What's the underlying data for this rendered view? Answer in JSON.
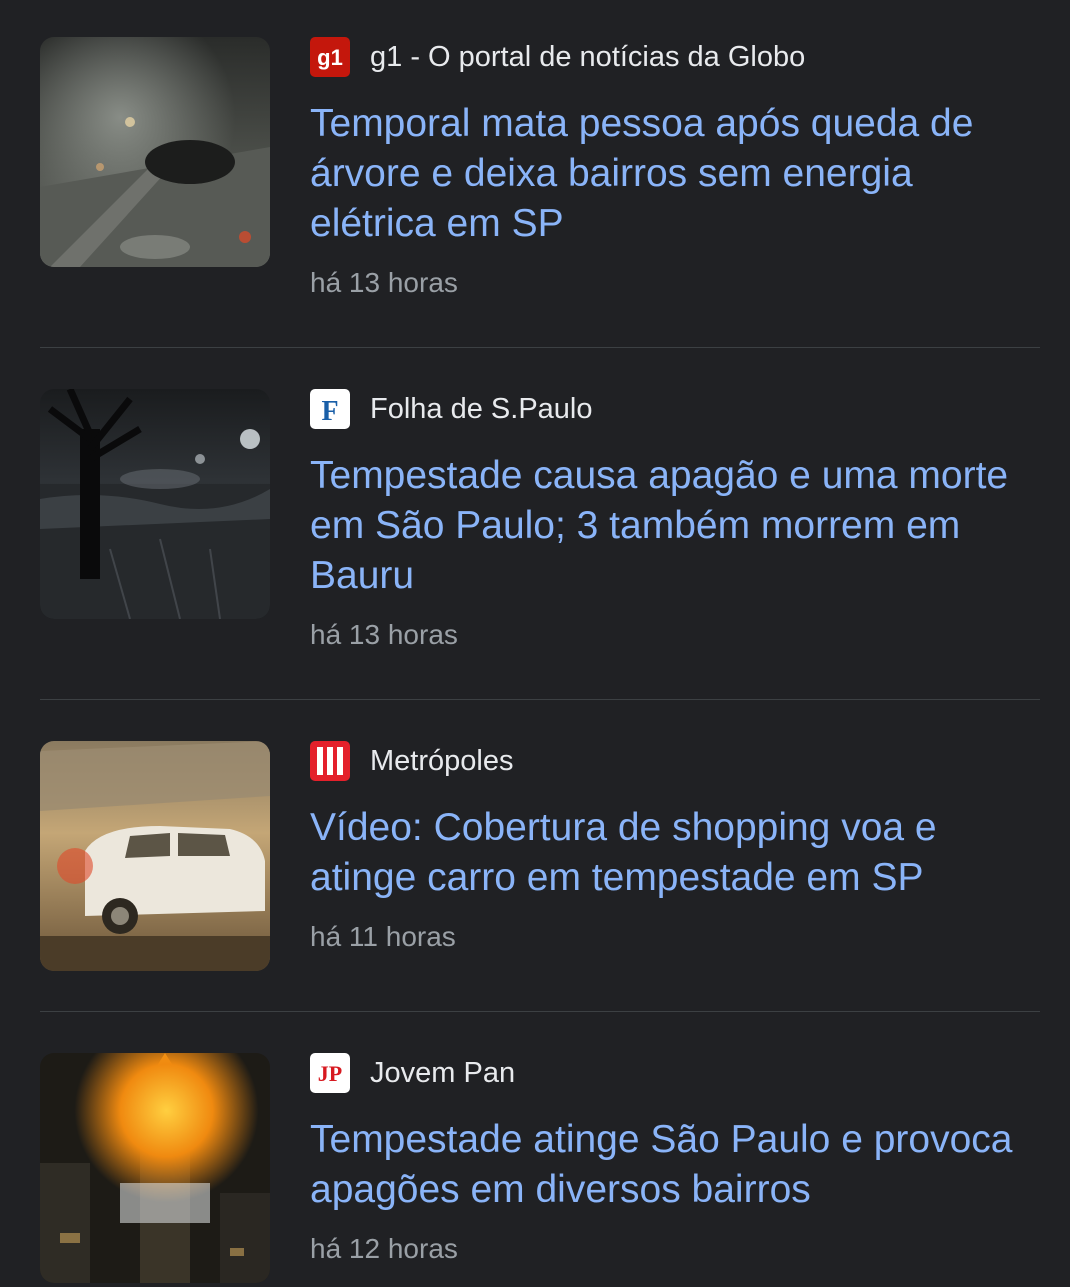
{
  "articles": [
    {
      "source": "g1 - O portal de notícias da Globo",
      "logo_icon": "g1-logo-icon",
      "logo_text": "g1",
      "headline": "Temporal mata pessoa após queda de árvore e deixa bairros sem energia elétrica em SP",
      "time": "há 13 horas",
      "thumbnail": "storm-street-night-image"
    },
    {
      "source": "Folha de S.Paulo",
      "logo_icon": "folha-logo-icon",
      "logo_text": "F",
      "headline": "Tempestade causa apagão e uma morte em São Paulo; 3 também morrem em Bauru",
      "time": "há 13 horas",
      "thumbnail": "flooded-street-tree-image"
    },
    {
      "source": "Metrópoles",
      "logo_icon": "metropoles-logo-icon",
      "logo_text": "",
      "headline": "Vídeo: Cobertura de shopping voa e atinge carro em tempestade em SP",
      "time": "há 11 horas",
      "thumbnail": "white-car-roof-image"
    },
    {
      "source": "Jovem Pan",
      "logo_icon": "jovem-pan-logo-icon",
      "logo_text": "JP",
      "headline": "Tempestade atinge São Paulo e provoca apagões em diversos bairros",
      "time": "há 12 horas",
      "thumbnail": "burning-tower-image"
    }
  ],
  "colors": {
    "background": "#202124",
    "headline": "#8ab4f8",
    "source_text": "#e8eaed",
    "time_text": "#9aa0a6",
    "divider": "#3c4043",
    "g1_red": "#c4170c",
    "metropoles_red": "#e4202b",
    "jovem_pan_red": "#d71920",
    "folha_blue": "#1a5fa8"
  }
}
